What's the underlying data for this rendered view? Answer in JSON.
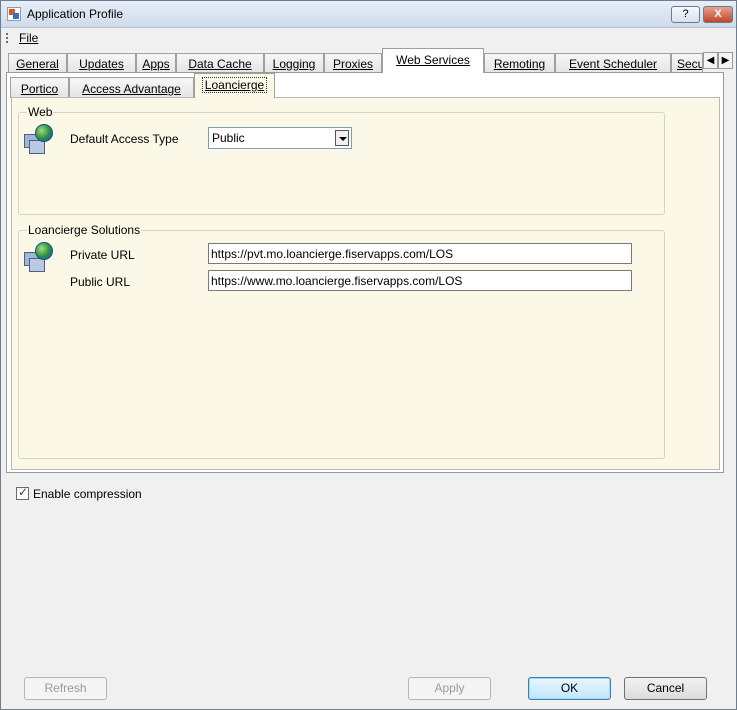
{
  "window": {
    "title": "Application Profile",
    "help_label": "?",
    "close_label": "X"
  },
  "menu": {
    "file_label": "File"
  },
  "tabs": [
    {
      "label": "General"
    },
    {
      "label": "Updates"
    },
    {
      "label": "Apps"
    },
    {
      "label": "Data Cache"
    },
    {
      "label": "Logging"
    },
    {
      "label": "Proxies"
    },
    {
      "label": "Web Services"
    },
    {
      "label": "Remoting"
    },
    {
      "label": "Event Scheduler"
    },
    {
      "label": "Secu"
    }
  ],
  "tab_scroll": {
    "left": "◀",
    "right": "▶"
  },
  "subtabs": [
    {
      "label": "Portico"
    },
    {
      "label": "Access Advantage"
    },
    {
      "label": "Loancierge"
    }
  ],
  "web_group": {
    "title": "Web",
    "default_access_label": "Default Access Type",
    "default_access_value": "Public"
  },
  "solutions_group": {
    "title": "Loancierge Solutions",
    "private_url_label": "Private URL",
    "private_url_value": "https://pvt.mo.loancierge.fiservapps.com/LOS",
    "public_url_label": "Public URL",
    "public_url_value": "https://www.mo.loancierge.fiservapps.com/LOS"
  },
  "compression": {
    "label": "Enable compression",
    "checked": true
  },
  "buttons": {
    "refresh": "Refresh",
    "apply": "Apply",
    "ok": "OK",
    "cancel": "Cancel"
  }
}
